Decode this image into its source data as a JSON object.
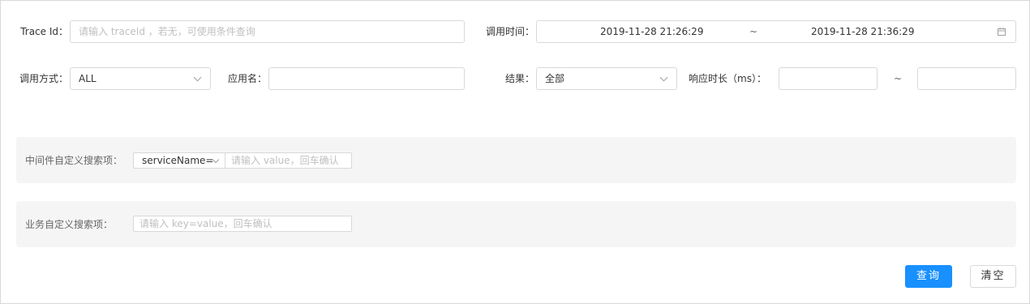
{
  "row1": {
    "trace_label": "Trace Id：",
    "trace_placeholder": "请输入 traceId ，若无，可使用条件查询",
    "time_label": "调用时间：",
    "time_start": "2019-11-28 21:26:29",
    "time_sep": "~",
    "time_end": "2019-11-28 21:36:29"
  },
  "row2": {
    "method_label": "调用方式：",
    "method_value": "ALL",
    "app_label": "应用名：",
    "app_value": "",
    "result_label": "结果：",
    "result_value": "全部",
    "duration_label": "响应时长（ms）：",
    "duration_min": "",
    "duration_sep": "~",
    "duration_max": ""
  },
  "middleware": {
    "label": "中间件自定义搜索项：",
    "key_value": "serviceName=",
    "value_placeholder": "请输入 value，回车确认"
  },
  "business": {
    "label": "业务自定义搜索项：",
    "placeholder": "请输入 key=value，回车确认"
  },
  "actions": {
    "query_label": "查询",
    "clear_label": "清空"
  },
  "colors": {
    "primary": "#1890ff",
    "panel_bg": "#f5f5f5",
    "border": "#d9d9d9"
  }
}
